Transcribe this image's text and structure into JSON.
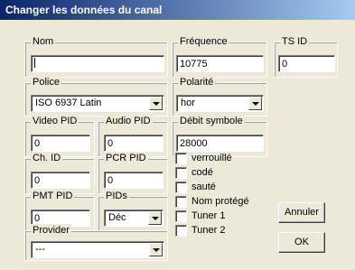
{
  "window": {
    "title": "Changer les données du canal"
  },
  "nom": {
    "label": "Nom",
    "value": ""
  },
  "frequence": {
    "label": "Fréquence",
    "value": "10775"
  },
  "tsid": {
    "label": "TS ID",
    "value": "0"
  },
  "police": {
    "label": "Police",
    "selected": "ISO 6937 Latin"
  },
  "polarite": {
    "label": "Polarité",
    "selected": "hor"
  },
  "video_pid": {
    "label": "Video PID",
    "value": "0"
  },
  "audio_pid": {
    "label": "Audio PID",
    "value": "0"
  },
  "debit_symbole": {
    "label": "Débit symbole",
    "value": "28000"
  },
  "ch_id": {
    "label": "Ch. ID",
    "value": "0"
  },
  "pcr_pid": {
    "label": "PCR PID",
    "value": "0"
  },
  "pmt_pid": {
    "label": "PMT PID",
    "value": "0"
  },
  "pids": {
    "label": "PIDs",
    "selected": "Déc"
  },
  "provider": {
    "label": "Provider",
    "selected": "---"
  },
  "checkboxes": [
    {
      "label": "verrouillé",
      "checked": false
    },
    {
      "label": "codé",
      "checked": false
    },
    {
      "label": "sauté",
      "checked": false
    },
    {
      "label": "Nom protégé",
      "checked": false
    },
    {
      "label": "Tuner 1",
      "checked": false
    },
    {
      "label": "Tuner 2",
      "checked": false
    }
  ],
  "buttons": {
    "cancel": "Annuler",
    "ok": "OK"
  }
}
